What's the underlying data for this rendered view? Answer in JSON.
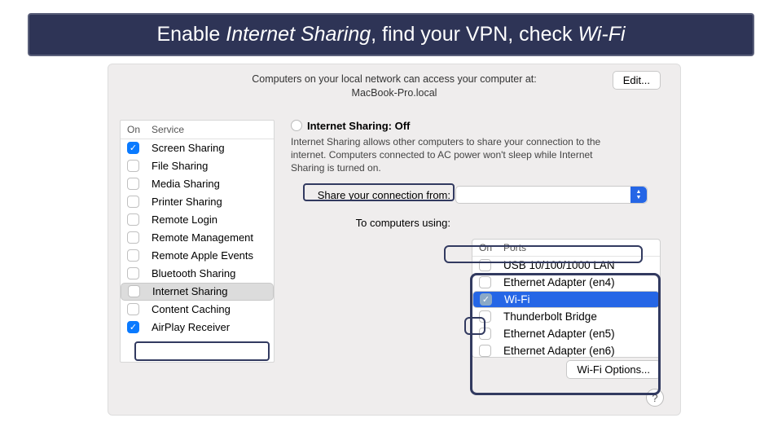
{
  "banner": {
    "pre": "Enable ",
    "em1": "Internet Sharing",
    "mid": ", find your VPN, check ",
    "em2": "Wi-Fi"
  },
  "top": {
    "line1": "Computers on your local network can access your computer at:",
    "line2": "MacBook-Pro.local",
    "edit": "Edit..."
  },
  "svc": {
    "col1": "On",
    "col2": "Service",
    "items": [
      {
        "on": true,
        "label": "Screen Sharing"
      },
      {
        "on": false,
        "label": "File Sharing"
      },
      {
        "on": false,
        "label": "Media Sharing"
      },
      {
        "on": false,
        "label": "Printer Sharing"
      },
      {
        "on": false,
        "label": "Remote Login"
      },
      {
        "on": false,
        "label": "Remote Management"
      },
      {
        "on": false,
        "label": "Remote Apple Events"
      },
      {
        "on": false,
        "label": "Bluetooth Sharing"
      },
      {
        "on": false,
        "label": "Internet Sharing",
        "sel": true
      },
      {
        "on": false,
        "label": "Content Caching"
      },
      {
        "on": true,
        "label": "AirPlay Receiver"
      }
    ]
  },
  "main": {
    "title": "Internet Sharing: Off",
    "desc": "Internet Sharing allows other computers to share your connection to the internet. Computers connected to AC power won't sleep while Internet Sharing is turned on.",
    "share_from": "Share your connection from:",
    "to_using": "To computers using:",
    "wifi_options": "Wi-Fi Options...",
    "help": "?"
  },
  "ports": {
    "col1": "On",
    "col2": "Ports",
    "items": [
      {
        "on": false,
        "label": "USB 10/100/1000 LAN"
      },
      {
        "on": false,
        "label": "Ethernet Adapter (en4)"
      },
      {
        "on": true,
        "label": "Wi-Fi",
        "sel": true
      },
      {
        "on": false,
        "label": "Thunderbolt Bridge"
      },
      {
        "on": false,
        "label": "Ethernet Adapter (en5)"
      },
      {
        "on": false,
        "label": "Ethernet Adapter (en6)"
      }
    ]
  }
}
